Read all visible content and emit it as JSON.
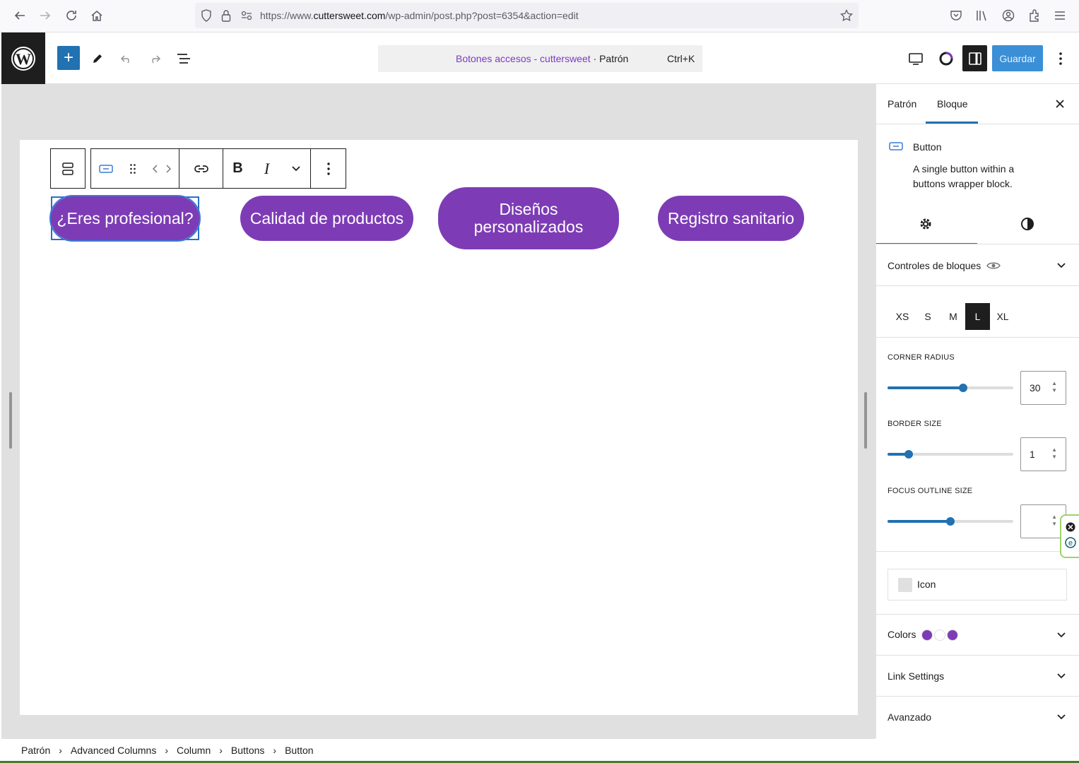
{
  "browser": {
    "url_prefix": "https://www.",
    "url_domain": "cuttersweet.com",
    "url_path": "/wp-admin/post.php?post=6354&action=edit"
  },
  "editor": {
    "document_title": "Botones accesos - cuttersweet",
    "document_type": "· Patrón",
    "shortcut": "Ctrl+K",
    "save_label": "Guardar"
  },
  "canvas": {
    "buttons": [
      {
        "label": "¿Eres profesional?"
      },
      {
        "label": "Calidad de productos"
      },
      {
        "label": "Diseños personalizados"
      },
      {
        "label": "Registro sanitario"
      }
    ],
    "button_color": "#7d3cb5"
  },
  "breadcrumb": [
    "Patrón",
    "Advanced Columns",
    "Column",
    "Buttons",
    "Button"
  ],
  "sidebar": {
    "tabs": [
      "Patrón",
      "Bloque"
    ],
    "active_tab": "Bloque",
    "block_title": "Button",
    "block_description": "A single button within a buttons wrapper block.",
    "block_controls_label": "Controles de bloques",
    "sizes": [
      "XS",
      "S",
      "M",
      "L",
      "XL"
    ],
    "active_size": "L",
    "corner_radius": {
      "label": "CORNER RADIUS",
      "value": "30",
      "slider_fraction": 0.6
    },
    "border_size": {
      "label": "BORDER SIZE",
      "value": "1",
      "slider_fraction": 0.17
    },
    "focus_outline": {
      "label": "FOCUS OUTLINE SIZE",
      "value": "",
      "slider_fraction": 0.5
    },
    "icon_label": "Icon",
    "colors_label": "Colors",
    "link_settings_label": "Link Settings",
    "advanced_label": "Avanzado",
    "color_swatches": [
      "#7d3cb5",
      "#ffffff",
      "#7d3cb5"
    ]
  }
}
